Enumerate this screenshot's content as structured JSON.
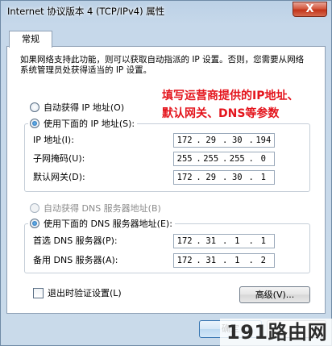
{
  "window": {
    "title": "Internet 协议版本 4 (TCP/IPv4) 属性",
    "close_label": "X"
  },
  "tabs": [
    {
      "label": "常规"
    }
  ],
  "description": "如果网络支持此功能，则可以获取自动指派的 IP 设置。否则，您需要从网络系统管理员处获得适当的 IP 设置。",
  "annotation": {
    "line1": "填写运营商提供的IP地址、",
    "line2": "默认网关、DNS等参数",
    "color": "#e4141c"
  },
  "ip": {
    "auto_label": "自动获得 IP 地址(O)",
    "manual_label": "使用下面的 IP 地址(S):",
    "selected": "manual",
    "fields": [
      {
        "label": "IP 地址(I):",
        "octets": [
          "172",
          "29",
          "30",
          "194"
        ]
      },
      {
        "label": "子网掩码(U):",
        "octets": [
          "255",
          "255",
          "255",
          "0"
        ]
      },
      {
        "label": "默认网关(D):",
        "octets": [
          "172",
          "29",
          "30",
          "1"
        ]
      }
    ]
  },
  "dns": {
    "auto_label": "自动获得 DNS 服务器地址(B)",
    "manual_label": "使用下面的 DNS 服务器地址(E):",
    "selected": "manual",
    "fields": [
      {
        "label": "首选 DNS 服务器(P):",
        "octets": [
          "172",
          "31",
          "1",
          "1"
        ]
      },
      {
        "label": "备用 DNS 服务器(A):",
        "octets": [
          "172",
          "31",
          "1",
          "2"
        ]
      }
    ]
  },
  "validate_on_exit": {
    "label": "退出时验证设置(L)",
    "checked": false
  },
  "buttons": {
    "advanced": "高级(V)...",
    "ok": "确定",
    "cancel": ""
  },
  "watermark": "191路由网"
}
